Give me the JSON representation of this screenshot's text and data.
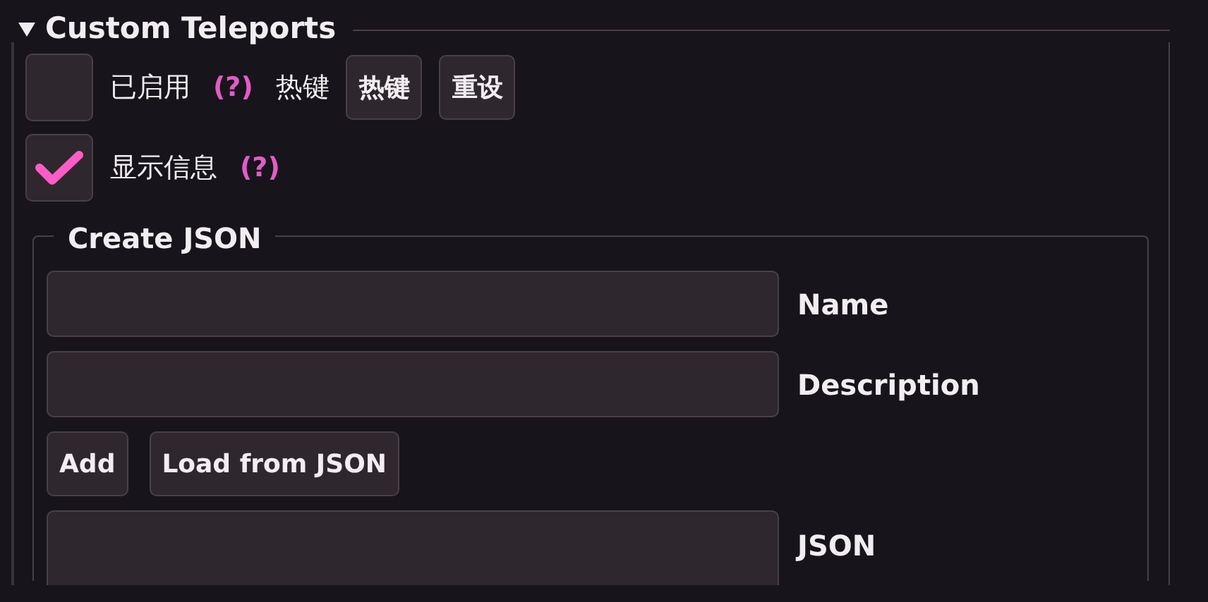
{
  "section": {
    "title": "Custom Teleports",
    "expanded": true
  },
  "options": [
    {
      "kind": "hotkey",
      "label": "已启用",
      "checked": false,
      "help": "(?)",
      "hotkey_label": "热键",
      "buttons": [
        "热键",
        "重设"
      ]
    },
    {
      "kind": "plain",
      "label": "显示信息",
      "checked": true,
      "help": "(?)"
    }
  ],
  "create_json": {
    "title": "Create JSON",
    "fields": [
      {
        "label": "Name"
      },
      {
        "label": "Description"
      }
    ],
    "buttons": [
      "Add",
      "Load from JSON"
    ],
    "json_field": {
      "label": "JSON"
    }
  }
}
